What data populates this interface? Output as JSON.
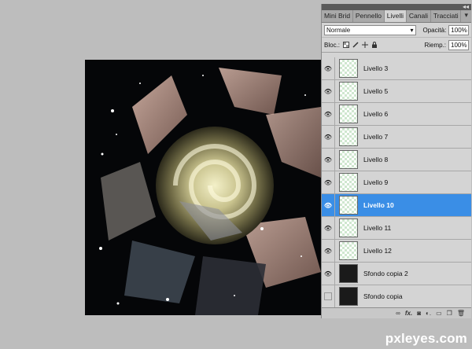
{
  "layers_panel": {
    "tabs": [
      "Mini Brid",
      "Pennello",
      "Livelli",
      "Canali",
      "Tracciati"
    ],
    "active_tab": "Livelli",
    "blend_mode": "Normale",
    "opacity_label": "Opacità:",
    "opacity_value": "100%",
    "lock_label": "Bloc.:",
    "fill_label": "Riemp.:",
    "fill_value": "100%",
    "layers": [
      {
        "name": "Livello 3",
        "selected": false
      },
      {
        "name": "Livello 5",
        "selected": false
      },
      {
        "name": "Livello 6",
        "selected": false
      },
      {
        "name": "Livello 7",
        "selected": false
      },
      {
        "name": "Livello 8",
        "selected": false
      },
      {
        "name": "Livello 9",
        "selected": false
      },
      {
        "name": "Livello 10",
        "selected": true
      },
      {
        "name": "Livello 11",
        "selected": false
      },
      {
        "name": "Livello 12",
        "selected": false
      },
      {
        "name": "Sfondo copia 2",
        "selected": false
      },
      {
        "name": "Sfondo copia",
        "selected": false
      }
    ],
    "bottom_icons": [
      "link-icon",
      "fx-icon",
      "mask-icon",
      "adjustment-icon",
      "folder-icon",
      "new-layer-icon",
      "trash-icon"
    ]
  },
  "watermark": "pxleyes.com",
  "colors": {
    "selection": "#3a8ee6",
    "panel": "#d4d4d4",
    "workspace": "#bdbdbd"
  }
}
